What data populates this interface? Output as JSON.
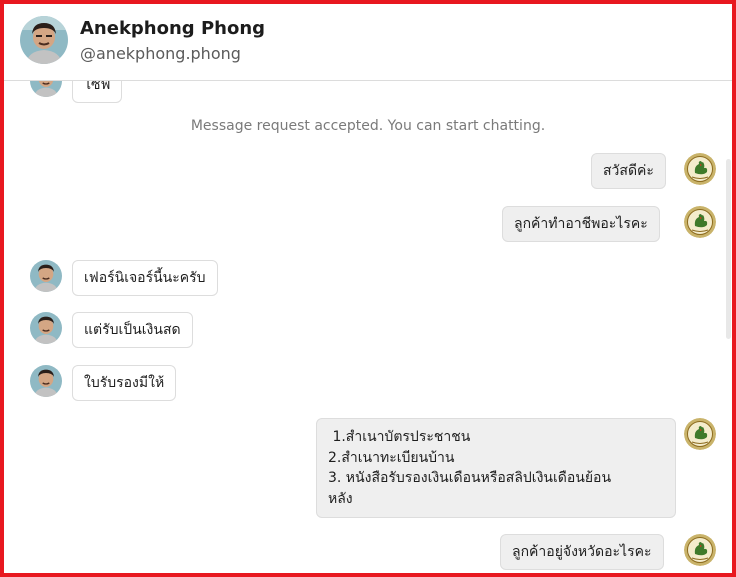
{
  "header": {
    "name": "Anekphong Phong",
    "handle": "@anekphong.phong"
  },
  "conversation": {
    "partial_top_message": "ไซฟ",
    "system_note": "Message request accepted. You can start chatting.",
    "messages": [
      {
        "direction": "outgoing",
        "text": "สวัสดีค่ะ"
      },
      {
        "direction": "outgoing",
        "text": "ลูกค้าทำอาชีพอะไรคะ"
      },
      {
        "direction": "incoming",
        "text": "เฟอร์นิเจอร์นี้นะครับ"
      },
      {
        "direction": "incoming",
        "text": "แต่รับเป็นเงินสด"
      },
      {
        "direction": "incoming",
        "text": "ใบรับรองมีให้"
      },
      {
        "direction": "outgoing",
        "lines": [
          " 1.สำเนาบัตรประชาชน",
          "2.สำเนาทะเบียนบ้าน",
          "3. หนังสือรับรองเงินเดือนหรือสลิปเงินเดือนย้อน",
          "หลัง"
        ]
      },
      {
        "direction": "outgoing",
        "text": "ลูกค้าอยู่จังหวัดอะไรคะ"
      }
    ]
  },
  "icons": {
    "user_avatar": "person-photo-avatar",
    "page_avatar": "rooster-logo-avatar"
  },
  "colors": {
    "frame_border": "#e8181f",
    "outgoing_bubble": "#efefef",
    "incoming_bubble": "#ffffff",
    "system_text": "#7a7a7a"
  }
}
